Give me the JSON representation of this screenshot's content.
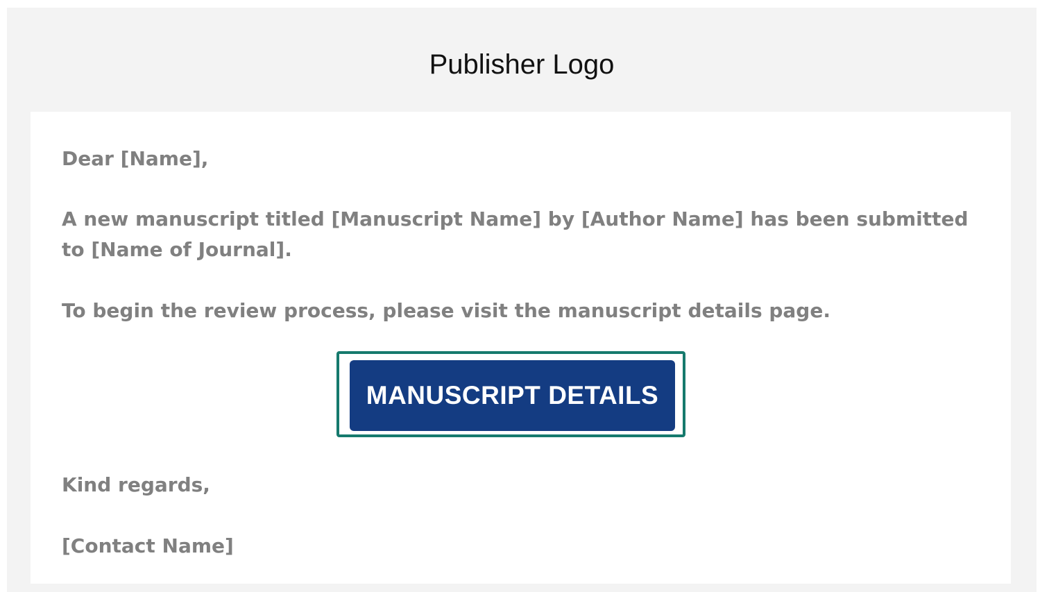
{
  "header": {
    "logo_text": "Publisher Logo"
  },
  "email": {
    "greeting": "Dear [Name],",
    "intro": "A new manuscript titled [Manuscript Name] by [Author Name] has been submitted to [Name of Journal].",
    "instruction": "To begin the review process, please visit the manuscript details page.",
    "cta_label": "MANUSCRIPT DETAILS",
    "closing": "Kind regards,",
    "signature": "[Contact Name]"
  },
  "colors": {
    "background": "#f3f3f3",
    "card": "#ffffff",
    "body_text": "#808080",
    "button": "#143c82",
    "focus_ring": "#167a6d"
  }
}
